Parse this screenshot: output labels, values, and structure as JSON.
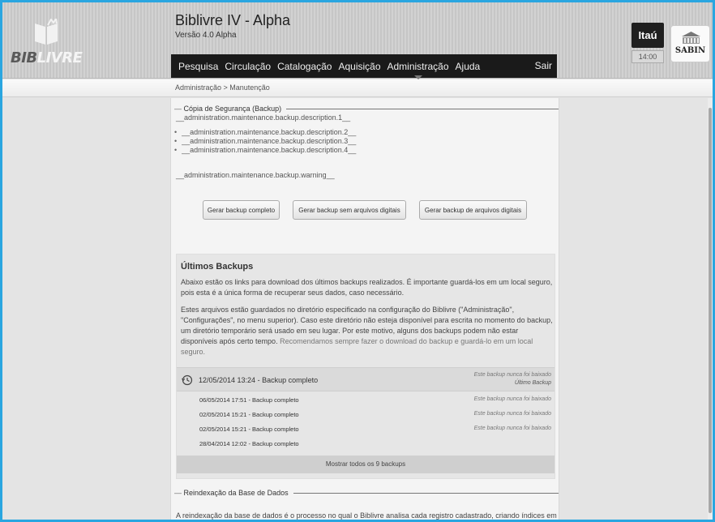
{
  "header": {
    "logo": {
      "bib": "BIB",
      "livre": "LIVRE"
    },
    "title": "Biblivre IV - Alpha",
    "version": "Versão 4.0 Alpha",
    "menu": [
      "Pesquisa",
      "Circulação",
      "Catalogação",
      "Aquisição",
      "Administração",
      "Ajuda"
    ],
    "active_menu": "Administração",
    "logout": "Sair",
    "sponsor": "Itaú",
    "clock": "14:00",
    "partner": "SABIN"
  },
  "breadcrumb": "Administração > Manutenção",
  "backup": {
    "legend": "Cópia de Segurança (Backup)",
    "description_1": "__administration.maintenance.backup.description.1__",
    "description_items": [
      "__administration.maintenance.backup.description.2__",
      "__administration.maintenance.backup.description.3__",
      "__administration.maintenance.backup.description.4__"
    ],
    "warning": "__administration.maintenance.backup.warning__",
    "buttons": {
      "full": "Gerar backup completo",
      "no_digital": "Gerar backup sem arquivos digitais",
      "digital": "Gerar backup de arquivos digitais"
    }
  },
  "last_backups": {
    "title": "Últimos Backups",
    "paragraph_1": "Abaixo estão os links para download dos últimos backups realizados. É importante guardá-los em um local seguro, pois esta é a única forma de recuperar seus dados, caso necessário.",
    "paragraph_2_main": "Estes arquivos estão guardados no diretório especificado na configuração do Biblivre (\"Administração\", \"Configurações\", no menu superior). Caso este diretório não esteja disponível para escrita no momento do backup, um diretório temporário será usado em seu lugar. Por este motivo, alguns dos backups podem não estar disponíveis após certo tempo.",
    "paragraph_2_muted": "Recomendamos sempre fazer o download do backup e guardá-lo em um local seguro.",
    "latest": {
      "label": "12/05/2014 13:24 - Backup completo",
      "status": "Este backup nunca foi baixado",
      "tag": "Último Backup"
    },
    "rows": [
      {
        "label": "06/05/2014 17:51 - Backup completo",
        "status": "Este backup nunca foi baixado"
      },
      {
        "label": "02/05/2014 15:21 - Backup completo",
        "status": "Este backup nunca foi baixado"
      },
      {
        "label": "02/05/2014 15:21 - Backup completo",
        "status": "Este backup nunca foi baixado"
      },
      {
        "label": "28/04/2014 12:02 - Backup completo",
        "status": ""
      }
    ],
    "show_all": "Mostrar todos os 9 backups"
  },
  "reindex": {
    "legend": "Reindexação da Base de Dados",
    "description": "A reindexação da base de dados é o processo no qual o Biblivre analisa cada registro cadastrado, criando índices em"
  }
}
